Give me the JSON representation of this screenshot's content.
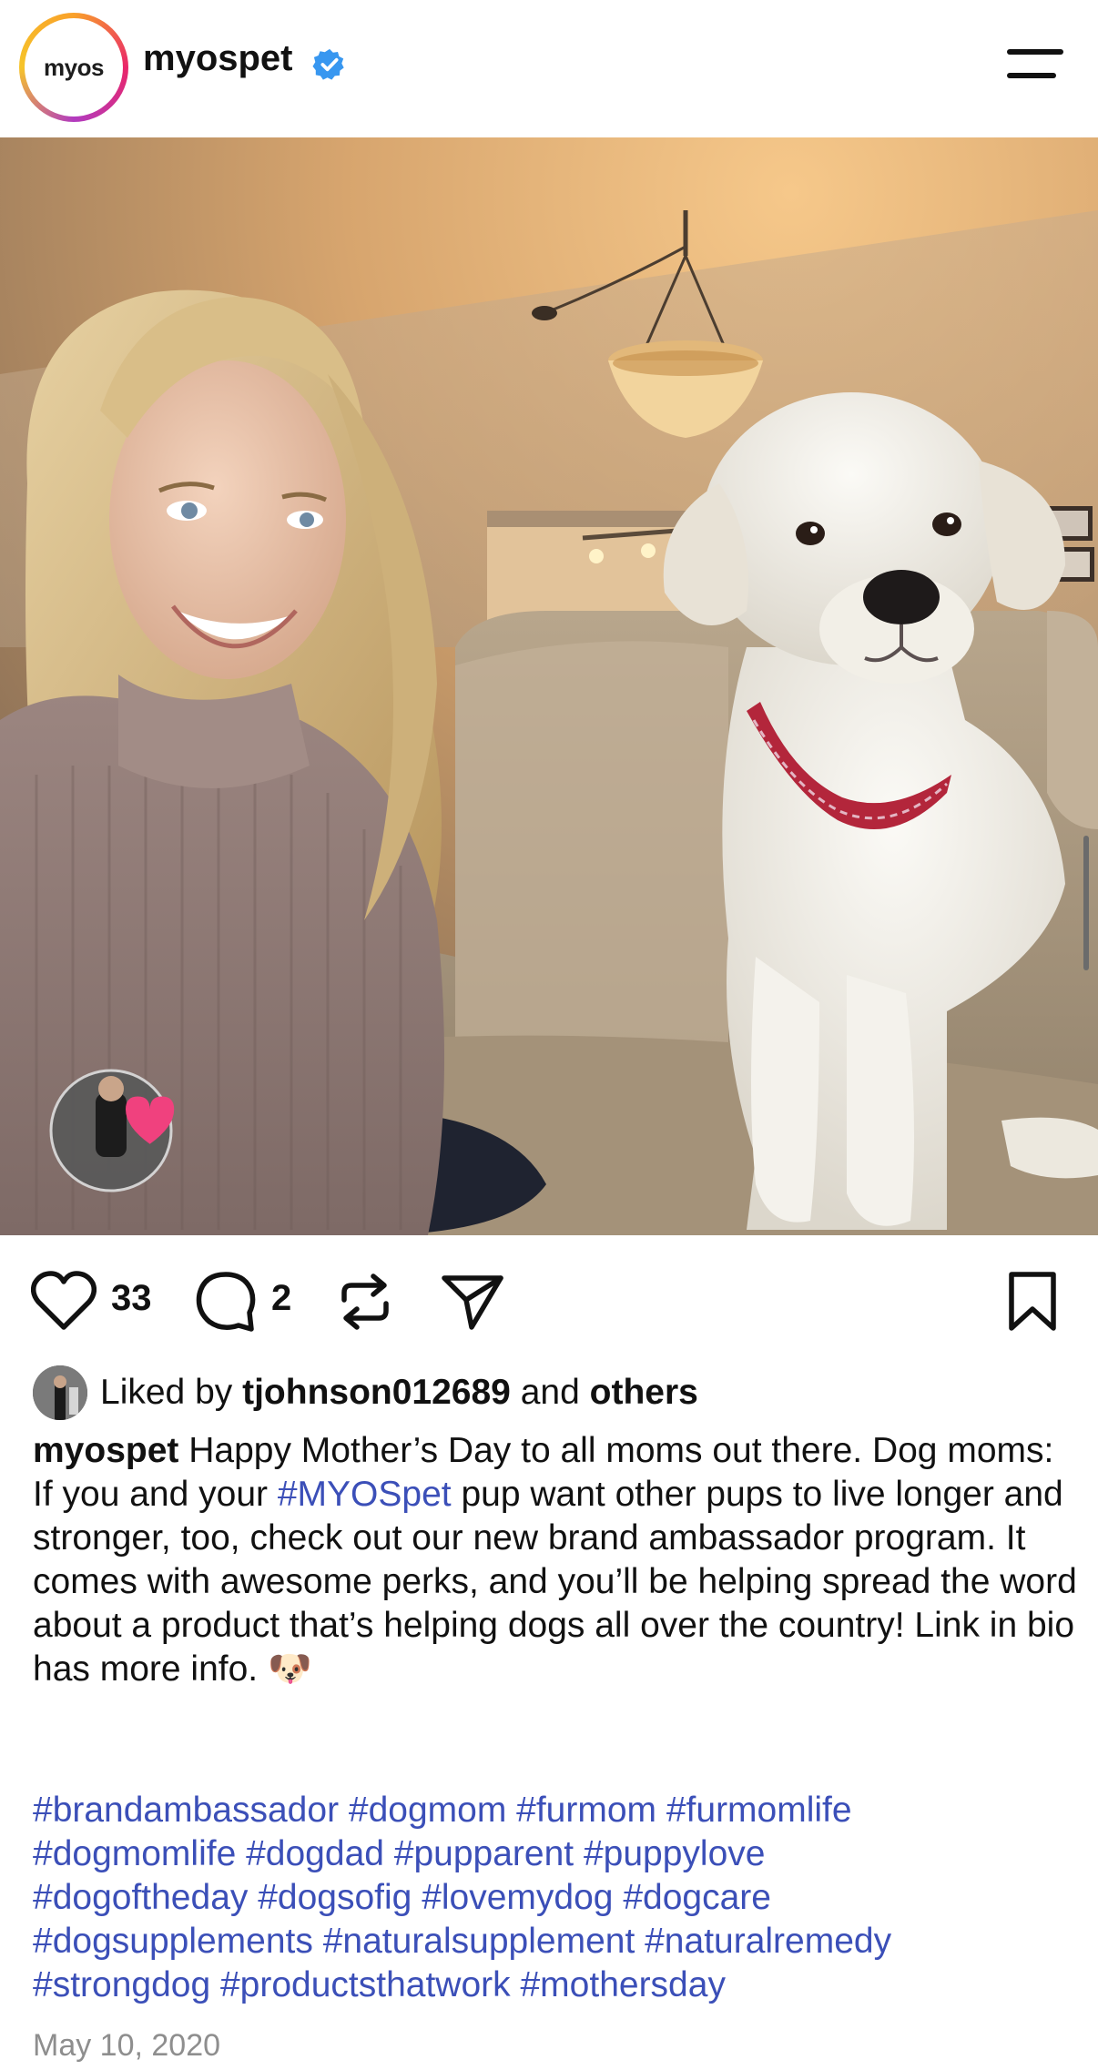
{
  "header": {
    "avatar_text": "myos",
    "username": "myospet",
    "verified_icon": "verified-badge-icon",
    "menu_icon": "hamburger-menu-icon"
  },
  "post": {
    "image_alt": "Smiling blonde woman in a mauve turtleneck sweater sitting on a beige couch next to a white labrador puppy wearing a red collar",
    "actions": {
      "like_count": "33",
      "comment_count": "2"
    },
    "liked_by": {
      "prefix": "Liked by",
      "user": "tjohnson012689",
      "joiner": "and",
      "others": "others"
    },
    "caption": {
      "username": "myospet",
      "text_before_tag": "Happy Mother’s Day to all moms out there. Dog moms: If you and your",
      "tag": "#MYOSpet",
      "text_after_tag": "pup want other pups to live longer and stronger, too, check out our new brand ambassador program. It comes with awesome perks, and you’ll be helping spread the word about a product that’s helping dogs all over the country! Link in bio has more info.",
      "emoji": "🐶"
    },
    "hashtags": [
      "#brandambassador #dogmom #furmom #furmomlife",
      "#dogmomlife #dogdad #pupparent #puppylove",
      "#dogoftheday #dogsofig #lovemydog #dogcare",
      "#dogsupplements #naturalsupplement #naturalremedy",
      "#strongdog #productsthatwork #mothersday"
    ],
    "date": "May 10, 2020"
  },
  "colors": {
    "link": "#3b4fb8",
    "verified": "#3897f0",
    "date": "#8e8e8e"
  }
}
